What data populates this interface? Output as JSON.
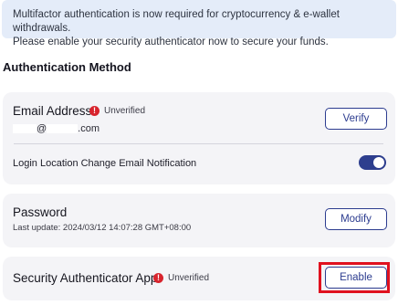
{
  "banner": {
    "line1": "Multifactor authentication is now required for cryptocurrency & e-wallet withdrawals.",
    "line2": "Please enable your security authenticator now to secure your funds."
  },
  "section": {
    "title": "Authentication Method"
  },
  "email": {
    "title": "Email Address",
    "status": "Unverified",
    "status_icon": "alert-icon",
    "masked_at": "@",
    "masked_domain": ".com",
    "button": "Verify"
  },
  "notification": {
    "label": "Login Location Change Email Notification",
    "enabled": true
  },
  "password": {
    "title": "Password",
    "last_update": "Last update: 2024/03/12 14:07:28 GMT+08:00",
    "button": "Modify"
  },
  "authenticator": {
    "title": "Security Authenticator App",
    "status": "Unverified",
    "status_icon": "alert-icon",
    "button": "Enable"
  },
  "colors": {
    "accent": "#2c3c8f",
    "alert": "#d8242d",
    "banner_bg": "#e4ecf9",
    "highlight": "#e0111f"
  }
}
